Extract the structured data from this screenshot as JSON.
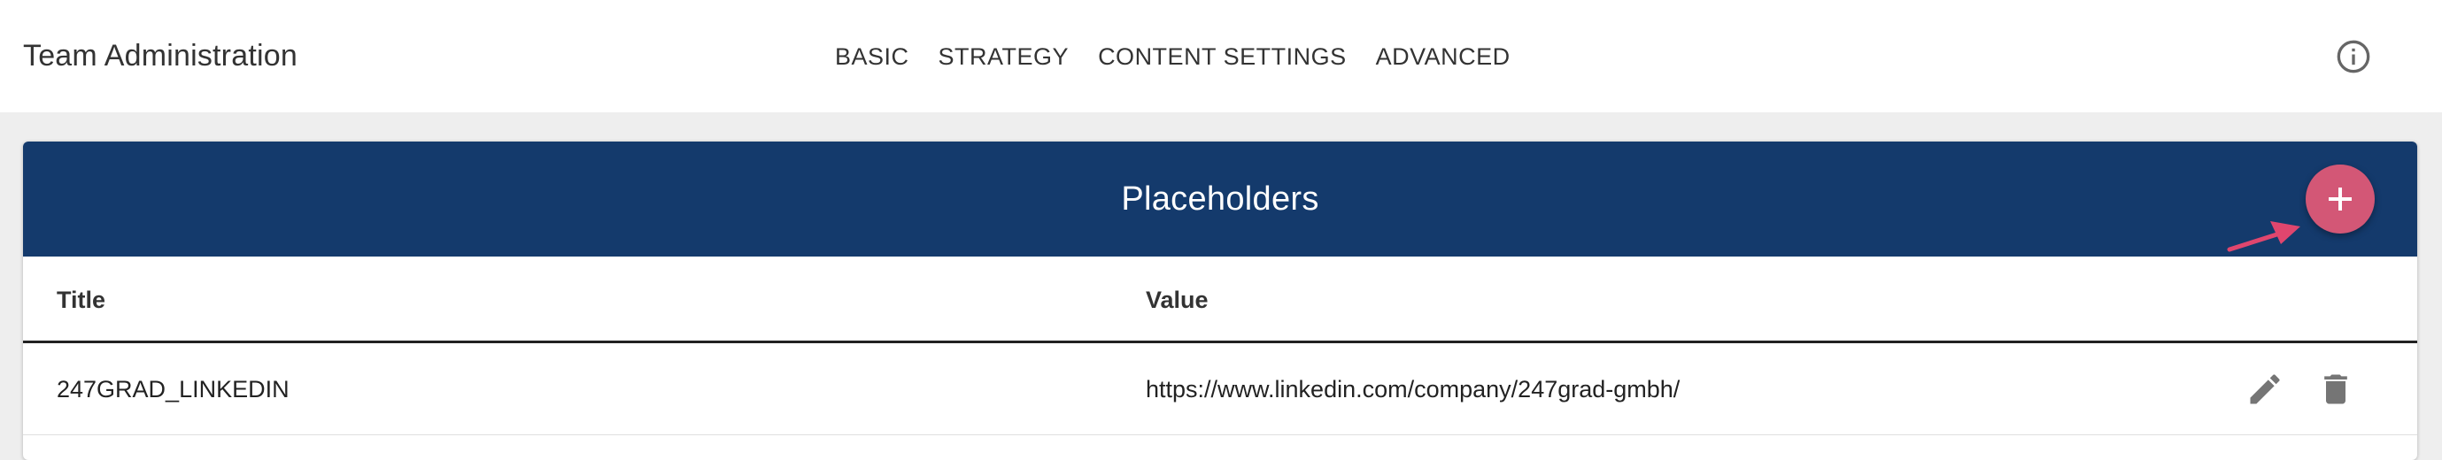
{
  "header": {
    "title": "Team Administration",
    "nav": [
      {
        "label": "BASIC"
      },
      {
        "label": "STRATEGY"
      },
      {
        "label": "CONTENT SETTINGS"
      },
      {
        "label": "ADVANCED"
      }
    ],
    "info_icon": "info-circle-icon"
  },
  "panel": {
    "title": "Placeholders",
    "add_icon": "plus-icon",
    "annotation_icon": "arrow-icon",
    "colors": {
      "header_bg": "#143a6c",
      "fab_bg": "#d35776",
      "annotation": "#e0466e"
    }
  },
  "table": {
    "columns": [
      "Title",
      "Value"
    ],
    "rows": [
      {
        "title": "247GRAD_LINKEDIN",
        "value": "https://www.linkedin.com/company/247grad-gmbh/",
        "actions": [
          "pencil-icon",
          "trash-icon"
        ]
      }
    ]
  }
}
